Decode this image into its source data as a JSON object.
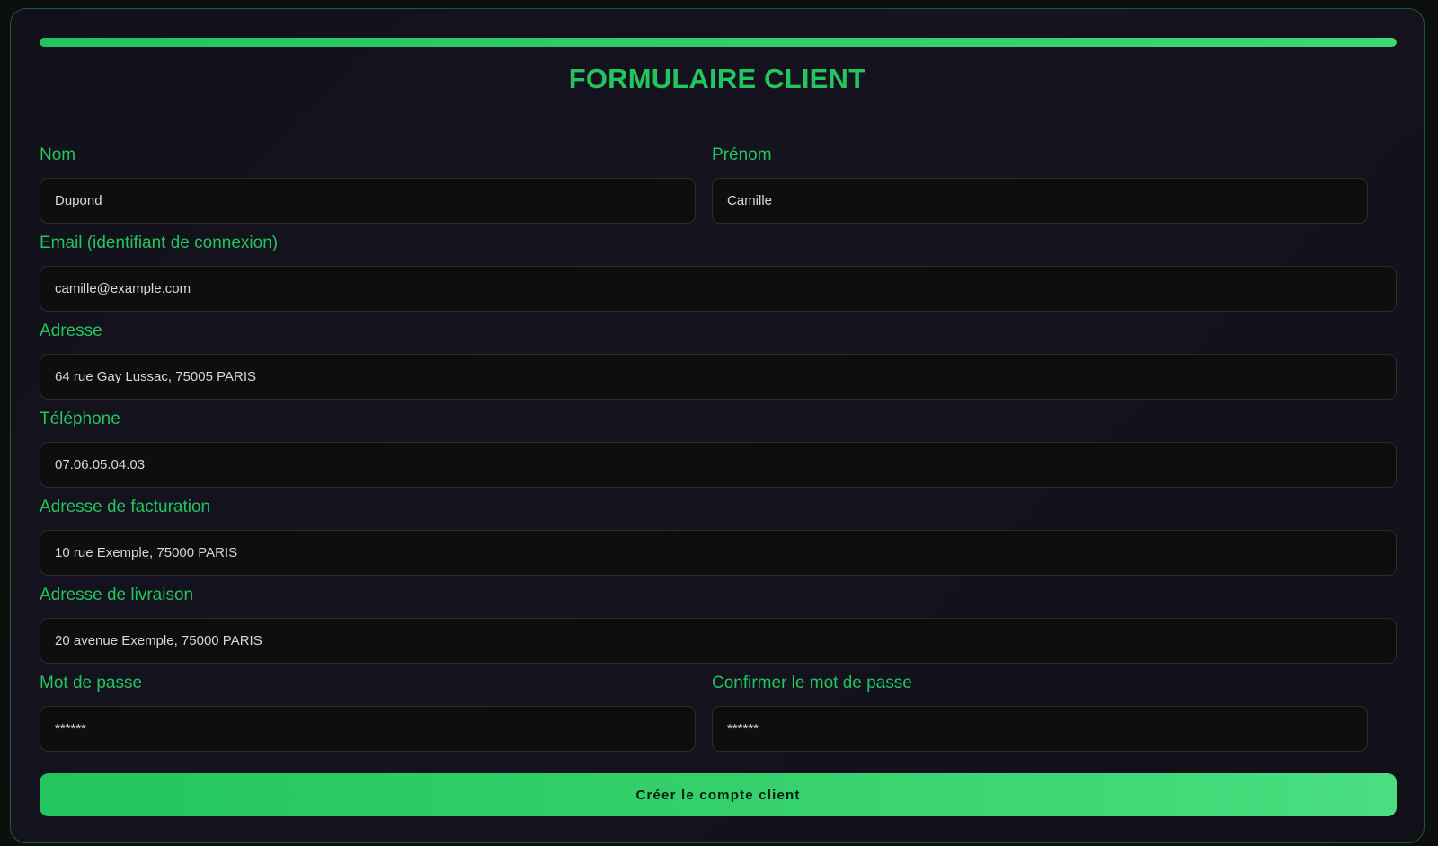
{
  "form": {
    "progress_percent": 100,
    "title": "FORMULAIRE CLIENT",
    "fields": [
      {
        "label": "Nom",
        "value": "Dupond"
      },
      {
        "label": "Prénom",
        "value": "Camille"
      },
      {
        "label": "Email (identifiant de connexion)",
        "value": "camille@example.com"
      },
      {
        "label": "Adresse",
        "value": "64 rue Gay Lussac, 75005 PARIS"
      },
      {
        "label": "Téléphone",
        "value": "07.06.05.04.03"
      },
      {
        "label": "Adresse de facturation",
        "value": "10 rue Exemple, 75000 PARIS"
      },
      {
        "label": "Adresse de livraison",
        "value": "20 avenue Exemple, 75000 PARIS"
      },
      {
        "label": "Mot de passe",
        "value": "******"
      },
      {
        "label": "Confirmer le mot de passe",
        "value": "******"
      }
    ],
    "submit_label": "Créer le compte client"
  },
  "colors": {
    "accent": "#22c55e",
    "background": "#12111b",
    "input_background": "#0e0e0f",
    "input_border": "#2a2c2e"
  }
}
